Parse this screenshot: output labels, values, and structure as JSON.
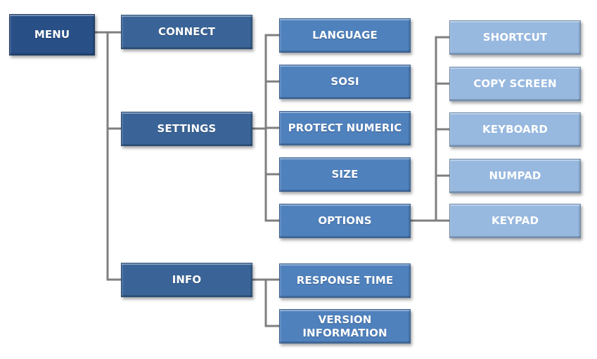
{
  "diagram": {
    "type": "menu-tree",
    "colors": {
      "level0": "#284f86",
      "level1": "#3a6497",
      "level2": "#4f81bd",
      "level3": "#97b8df",
      "connector": "#7f7f7f",
      "text": "#ffffff"
    },
    "root": {
      "label": "MENU"
    },
    "level1": [
      {
        "label": "CONNECT"
      },
      {
        "label": "SETTINGS"
      },
      {
        "label": "INFO"
      }
    ],
    "settings_children": [
      {
        "label": "LANGUAGE"
      },
      {
        "label": "SOSI"
      },
      {
        "label": "PROTECT NUMERIC"
      },
      {
        "label": "SIZE"
      },
      {
        "label": "OPTIONS"
      }
    ],
    "options_children": [
      {
        "label": "SHORTCUT"
      },
      {
        "label": "COPY SCREEN"
      },
      {
        "label": "KEYBOARD"
      },
      {
        "label": "NUMPAD"
      },
      {
        "label": "KEYPAD"
      }
    ],
    "info_children": [
      {
        "label": "RESPONSE TIME"
      },
      {
        "label": "VERSION INFORMATION"
      }
    ]
  }
}
